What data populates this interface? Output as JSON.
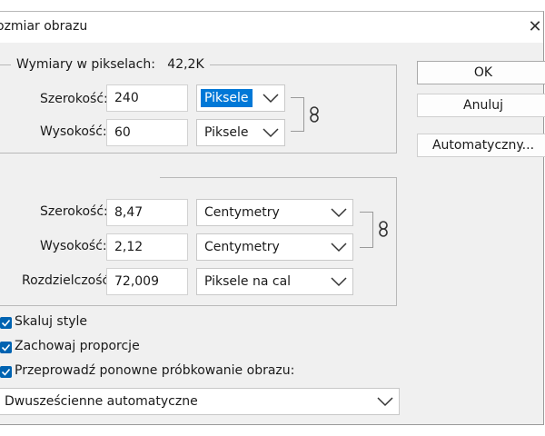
{
  "window": {
    "title": "ozmiar obrazu",
    "close_glyph": "✕"
  },
  "pixel_dimensions": {
    "legend": "Wymiary w pikselach:",
    "size": "42,2K",
    "width_label": "Szerokość:",
    "width_value": "240",
    "width_unit": "Piksele",
    "height_label": "Wysokość:",
    "height_value": "60",
    "height_unit": "Piksele"
  },
  "document_size": {
    "width_label": "Szerokość:",
    "width_value": "8,47",
    "width_unit": "Centymetry",
    "height_label": "Wysokość:",
    "height_value": "2,12",
    "height_unit": "Centymetry",
    "resolution_label": "Rozdzielczość:",
    "resolution_value": "72,009",
    "resolution_unit": "Piksele na cal"
  },
  "buttons": {
    "ok": "OK",
    "cancel": "Anuluj",
    "auto": "Automatyczny..."
  },
  "options": {
    "scale_styles": {
      "label": "Skaluj style",
      "checked": true
    },
    "constrain": {
      "label": "Zachowaj proporcje",
      "checked": true
    },
    "resample": {
      "label": "Przeprowadź ponowne próbkowanie obrazu:",
      "checked": true
    },
    "method": "Dwusześcienne automatyczne"
  },
  "icons": {
    "close": "close-icon",
    "chevron": "chevron-down-icon",
    "link": "chain-link-icon",
    "check": "checkmark-icon"
  },
  "colors": {
    "accent": "#0078d7",
    "checkbox": "#0063b1"
  }
}
